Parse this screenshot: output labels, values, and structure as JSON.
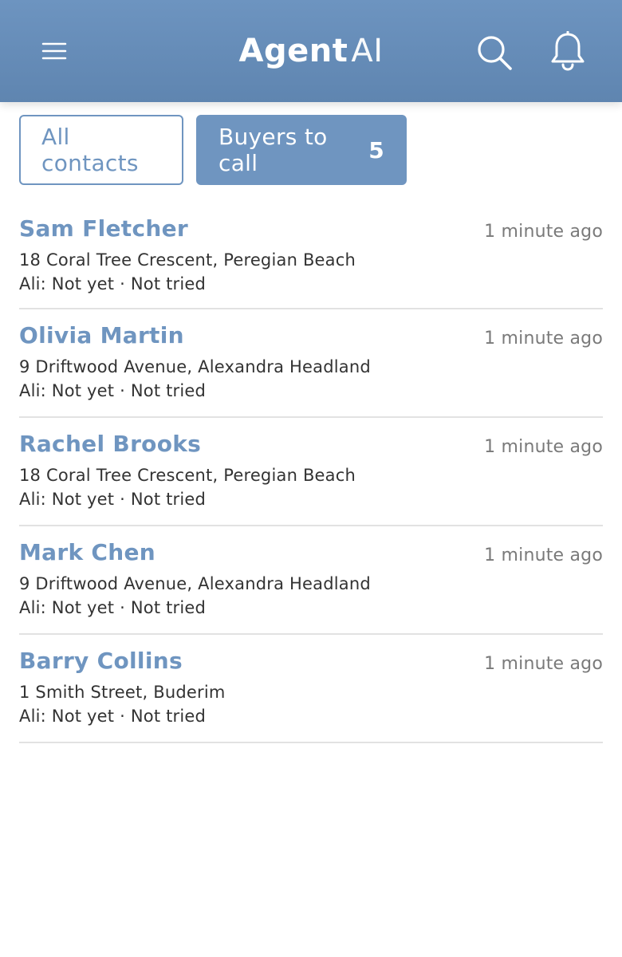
{
  "header": {
    "brand_bold": "Agent",
    "brand_light": "AI",
    "icons": {
      "menu": "hamburger-menu-icon",
      "search": "search-icon",
      "notifications": "bell-icon"
    },
    "color": "#6d94c0"
  },
  "tabs": [
    {
      "label": "All contacts",
      "active": false
    },
    {
      "label": "Buyers to call",
      "count": "5",
      "active": true
    }
  ],
  "contacts": [
    {
      "name": "Sam Fletcher",
      "time": "1 minute ago",
      "address": "18 Coral Tree Crescent, Peregian Beach",
      "status": "Ali: Not yet · Not tried"
    },
    {
      "name": "Olivia Martin",
      "time": "1 minute ago",
      "address": "9 Driftwood Avenue, Alexandra Headland",
      "status": "Ali: Not yet · Not tried"
    },
    {
      "name": "Rachel Brooks",
      "time": "1 minute ago",
      "address": "18 Coral Tree Crescent, Peregian Beach",
      "status": "Ali: Not yet · Not tried"
    },
    {
      "name": "Mark Chen",
      "time": "1 minute ago",
      "address": "9 Driftwood Avenue, Alexandra Headland",
      "status": "Ali: Not yet · Not tried"
    },
    {
      "name": "Barry Collins",
      "time": "1 minute ago",
      "address": "1 Smith Street, Buderim",
      "status": "Ali: Not yet · Not tried"
    }
  ],
  "colors": {
    "accent": "#6f95c0",
    "divider": "#e2e2e2",
    "muted_text": "#7a7a7a",
    "body_text": "#333333"
  }
}
